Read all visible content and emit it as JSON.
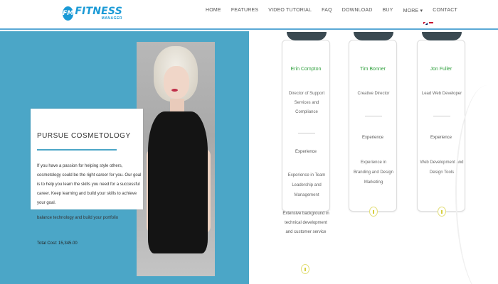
{
  "header": {
    "logo_badge": "FM",
    "logo_main": "FITNESS",
    "logo_sub": "MANAGER",
    "nav": [
      {
        "label": "HOME"
      },
      {
        "label": "FEATURES"
      },
      {
        "label": "VIDEO TUTORIAL"
      },
      {
        "label": "FAQ"
      },
      {
        "label": "DOWNLOAD"
      },
      {
        "label": "BUY"
      },
      {
        "label": "MORE ▾"
      },
      {
        "label": "CONTACT"
      }
    ]
  },
  "course": {
    "title": "PURSUE COSMETOLOGY",
    "body": "If you have a passion for helping style others, cosmetology could be the right career for you. Our goal is to help you learn the skills you need for a successful career. Keep learning and build your skills to achieve your goal.",
    "body_extra": "balance technology and build your portfolio",
    "cost": "Total Cost: 15,345.00"
  },
  "team": [
    {
      "name": "Erin Compton",
      "role": "Director of Support Services and Compliance",
      "experience_label": "Experience",
      "experience": "Experience in Team Leadership and Management"
    },
    {
      "name": "Tim Bonner",
      "role": "Creative Director",
      "experience_label": "Experience",
      "experience": "Experience in Branding and Design Marketing"
    },
    {
      "name": "Jon Fuller",
      "role": "Lead Web Developer",
      "experience_label": "Experience",
      "experience": "Web Development and Design Tools"
    }
  ],
  "extra_text": "Extensive background in technical development and customer service",
  "colors": {
    "accent_blue": "#4ba6c7",
    "brand_blue": "#1a9ad6",
    "name_green": "#2e9f3c"
  }
}
